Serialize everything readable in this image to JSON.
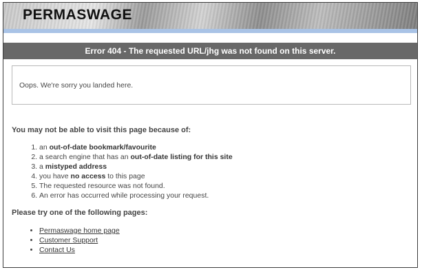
{
  "header": {
    "logo_text": "PERMASWAGE",
    "error_title": "Error 404 - The requested URL/jhg was not found on this server."
  },
  "notice": {
    "text": "Oops. We're sorry you landed here."
  },
  "reasons": {
    "heading": "You may not be able to visit this page because of:",
    "items": [
      {
        "prefix": "an ",
        "bold": "out-of-date bookmark/favourite",
        "suffix": ""
      },
      {
        "prefix": "a search engine that has an ",
        "bold": "out-of-date listing for this site",
        "suffix": ""
      },
      {
        "prefix": "a ",
        "bold": "mistyped address",
        "suffix": ""
      },
      {
        "prefix": "you have ",
        "bold": "no access",
        "suffix": " to this page"
      },
      {
        "prefix": "The requested resource was not found.",
        "bold": "",
        "suffix": ""
      },
      {
        "prefix": "An error has occurred while processing your request.",
        "bold": "",
        "suffix": ""
      }
    ]
  },
  "alternatives": {
    "heading": "Please try one of the following pages:",
    "links": [
      "Permaswage home page",
      "Customer Support",
      "Contact Us"
    ]
  },
  "colors": {
    "accent_rule": "#a9c3e6",
    "error_bar": "#686868"
  }
}
